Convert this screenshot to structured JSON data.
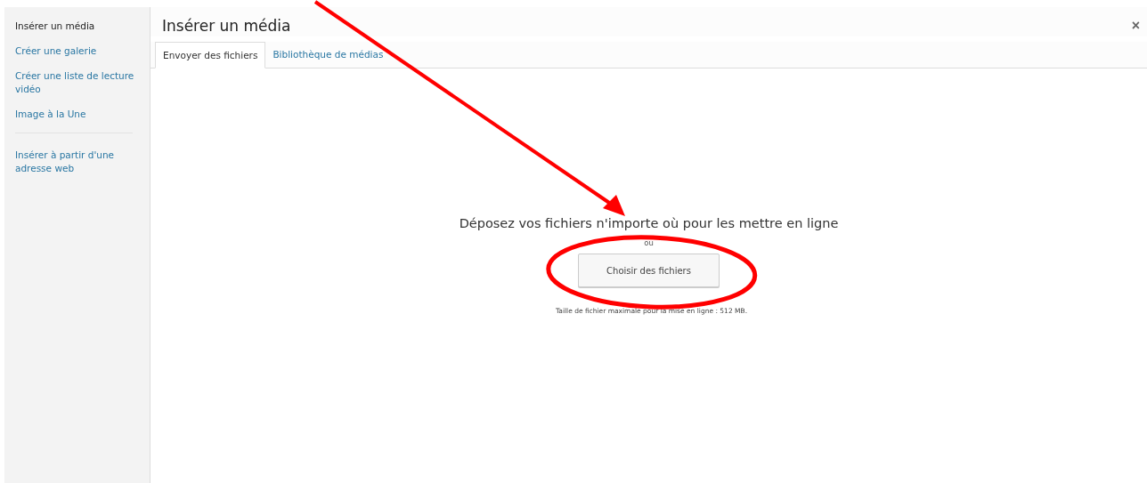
{
  "sidebar": {
    "sections": [
      {
        "items": [
          {
            "label": "Insérer un média",
            "selected": true
          },
          {
            "label": "Créer une galerie",
            "selected": false
          },
          {
            "label": "Créer une liste de lecture vidéo",
            "selected": false
          },
          {
            "label": "Image à la Une",
            "selected": false
          }
        ]
      },
      {
        "items": [
          {
            "label": "Insérer à partir d'une adresse web",
            "selected": false
          }
        ]
      }
    ]
  },
  "title": "Insérer un média",
  "close": "×",
  "tabs": [
    {
      "label": "Envoyer des fichiers",
      "selected": true
    },
    {
      "label": "Bibliothèque de médias",
      "selected": false
    }
  ],
  "uploader": {
    "heading": "Déposez vos fichiers n'importe où pour les mettre en ligne",
    "or": "ou",
    "button": "Choisir des fichiers",
    "max_size": "Taille de fichier maximale pour la mise en ligne : 512 MB."
  }
}
